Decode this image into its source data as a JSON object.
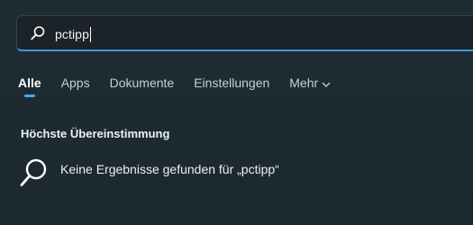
{
  "search": {
    "value": "pctipp"
  },
  "tabs": [
    {
      "label": "Alle"
    },
    {
      "label": "Apps"
    },
    {
      "label": "Dokumente"
    },
    {
      "label": "Einstellungen"
    },
    {
      "label": "Mehr"
    }
  ],
  "section": {
    "title": "Höchste Übereinstimmung"
  },
  "result": {
    "text": "Keine Ergebnisse gefunden für „pctipp“",
    "icon": "search-icon"
  },
  "colors": {
    "accent": "#4aa6e6",
    "background": "#1e2a30"
  }
}
